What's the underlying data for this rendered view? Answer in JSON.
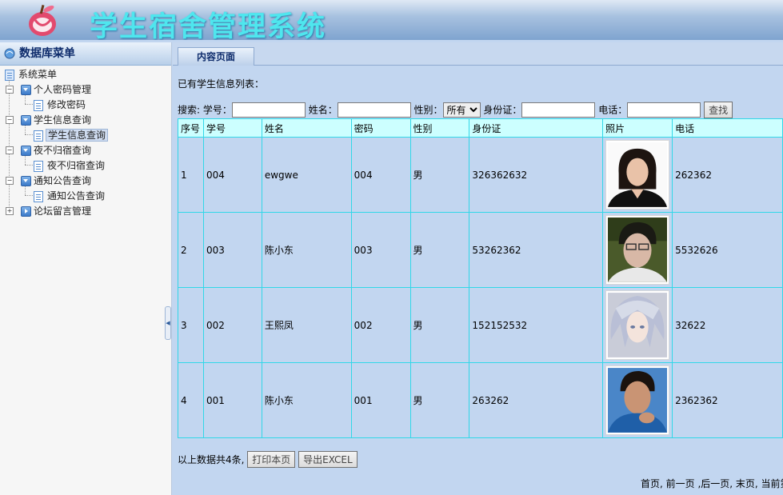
{
  "app": {
    "title": "学生宿舍管理系统"
  },
  "sidebar": {
    "header": "数据库菜单",
    "root": "系统菜单",
    "groups": [
      {
        "label": "个人密码管理",
        "children": [
          "修改密码"
        ]
      },
      {
        "label": "学生信息查询",
        "children": [
          "学生信息查询"
        ]
      },
      {
        "label": "夜不归宿查询",
        "children": [
          "夜不归宿查询"
        ]
      },
      {
        "label": "通知公告查询",
        "children": [
          "通知公告查询"
        ]
      },
      {
        "label": "论坛留言管理",
        "children": []
      }
    ]
  },
  "tab": {
    "label": "内容页面"
  },
  "main": {
    "list_title": "已有学生信息列表：",
    "search": {
      "prefix_label": "搜索: 学号：",
      "name_label": "姓名：",
      "gender_label": "性别：",
      "gender_selected": "所有",
      "id_label": "身份证：",
      "phone_label": "电话：",
      "button": "查找",
      "student_no_value": "",
      "name_value": "",
      "id_value": "",
      "phone_value": ""
    },
    "table": {
      "headers": [
        "序号",
        "学号",
        "姓名",
        "密码",
        "性别",
        "身份证",
        "照片",
        "电话"
      ],
      "rows": [
        {
          "index": "1",
          "student_no": "004",
          "name": "ewgwe",
          "password": "004",
          "gender": "男",
          "id_card": "326362632",
          "photo": "photo-woman",
          "phone": "262362"
        },
        {
          "index": "2",
          "student_no": "003",
          "name": "陈小东",
          "password": "003",
          "gender": "男",
          "id_card": "53262362",
          "photo": "photo-young-man",
          "phone": "5532626"
        },
        {
          "index": "3",
          "student_no": "002",
          "name": "王熙凤",
          "password": "002",
          "gender": "男",
          "id_card": "152152532",
          "photo": "photo-anime",
          "phone": "32622"
        },
        {
          "index": "4",
          "student_no": "001",
          "name": "陈小东",
          "password": "001",
          "gender": "男",
          "id_card": "263262",
          "photo": "photo-man-blue",
          "phone": "2362362"
        }
      ]
    },
    "footer": {
      "summary": "以上数据共4条,",
      "print_button": "打印本页",
      "export_button": "导出EXCEL"
    },
    "pager": "首页, 前一页 ,后一页, 末页, 当前第"
  },
  "colors": {
    "table_border": "#31d7e8",
    "header_bg": "#ccffff",
    "page_bg": "#c2d6f0",
    "title_color": "#4fe6ee"
  }
}
